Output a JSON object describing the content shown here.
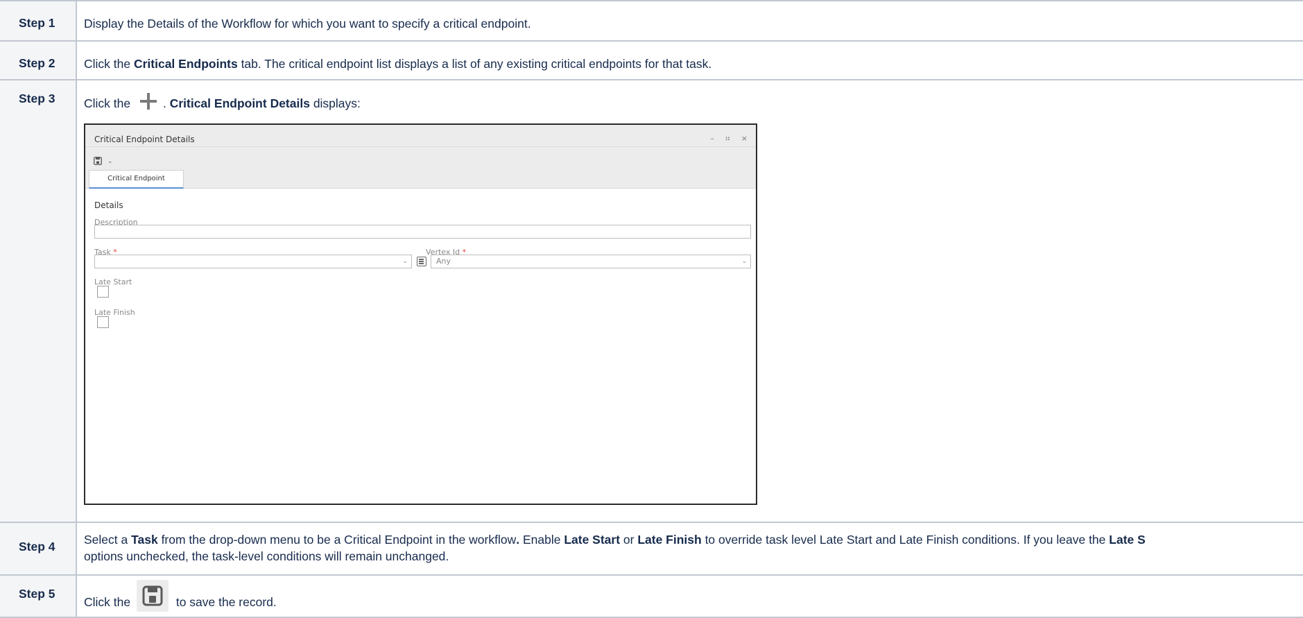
{
  "steps": [
    {
      "label": "Step 1",
      "text": "Display the Details of the Workflow for which you want to specify a critical endpoint."
    },
    {
      "label": "Step 2",
      "pre": "Click the ",
      "bold": "Critical Endpoints",
      "post": " tab. The critical endpoint list displays a list of any existing critical endpoints for that task."
    },
    {
      "label": "Step 3",
      "pre": "Click the ",
      "icon": "plus-icon",
      "mid": ". ",
      "bold": "Critical Endpoint Details",
      "post": " displays:"
    },
    {
      "label": "Step 4",
      "t1": "Select a ",
      "b1": "Task",
      "t2": " from the drop-down menu to be a Critical Endpoint in the workflow",
      "b2": ".",
      "t3": " Enable ",
      "b3": "Late Start",
      "t4": " or ",
      "b4": "Late Finish",
      "t5": " to override task level Late Start and Late Finish conditions. If you leave the ",
      "b5": "Late S",
      "line2": "options unchecked, the task-level conditions will remain unchanged."
    },
    {
      "label": "Step 5",
      "pre": "Click the ",
      "icon": "save-icon",
      "post": " to save the record."
    }
  ],
  "dialog": {
    "title": "Critical Endpoint Details",
    "window_buttons": "– ⠶ ×",
    "toolbar_chevron": "⌄",
    "tab": "Critical Endpoint",
    "section": "Details",
    "description_label": "Description",
    "description_value": "",
    "task_label": "Task",
    "task_required": "*",
    "task_value": "",
    "vertex_label": "Vertex Id",
    "vertex_required": "*",
    "vertex_value": "Any",
    "late_start_label": "Late Start",
    "late_start_checked": false,
    "late_finish_label": "Late Finish",
    "late_finish_checked": false
  }
}
